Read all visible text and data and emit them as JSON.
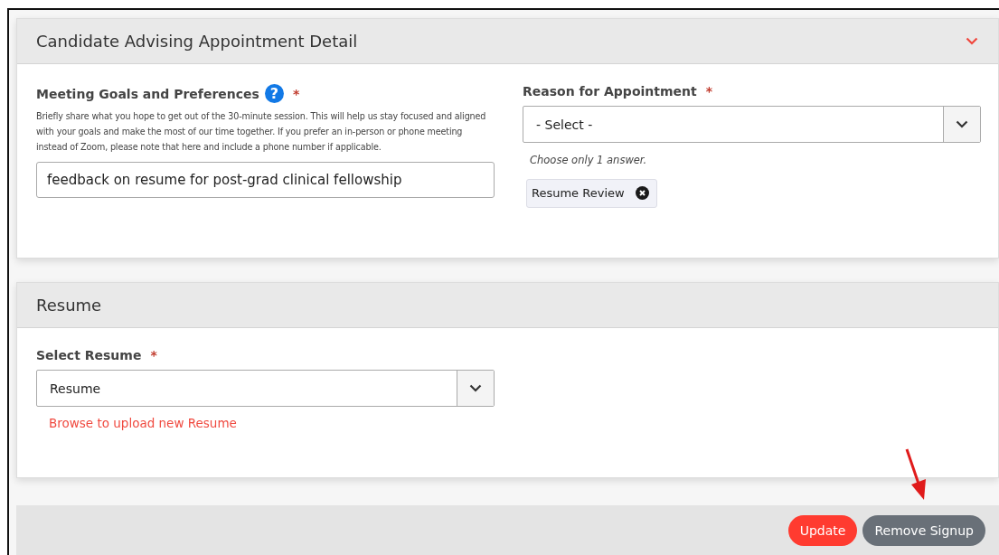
{
  "sections": [
    {
      "title": "Candidate Advising Appointment Detail",
      "expanded": true
    },
    {
      "title": "Resume"
    }
  ],
  "goals": {
    "label": "Meeting Goals and Preferences",
    "help": "?",
    "required_mark": "*",
    "description": "Briefly share what you hope to get out of the 30-minute session. This will help us stay focused and aligned with your goals and make the most of our time together. If you prefer an in-person or phone meeting instead of Zoom, please note that here and include a phone number if applicable.",
    "value": "feedback on resume for post-grad clinical fellowship"
  },
  "reason": {
    "label": "Reason for Appointment",
    "required_mark": "*",
    "value": "- Select -",
    "hint": "Choose only 1 answer.",
    "chips": [
      "Resume Review"
    ]
  },
  "resume": {
    "label": "Select Resume",
    "required_mark": "*",
    "value": "Resume",
    "link": "Browse to upload new Resume"
  },
  "buttons": [
    {
      "label": "Update",
      "kind": "primary"
    },
    {
      "label": "Remove Signup",
      "kind": "secondary"
    }
  ]
}
